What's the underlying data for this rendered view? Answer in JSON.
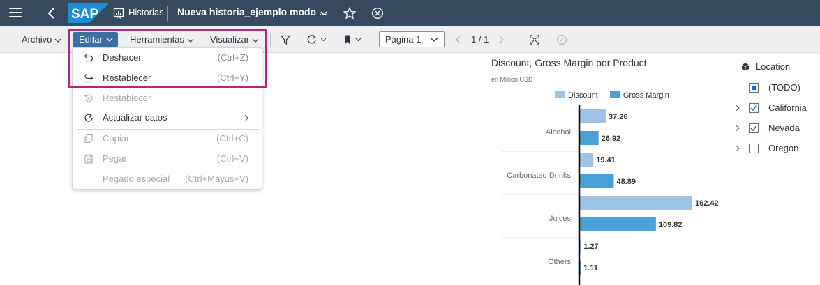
{
  "shell": {
    "logo_text": "SAP",
    "app_name": "Historias",
    "story_title": "Nueva historia_ejemplo modo ..."
  },
  "toolbar": {
    "archivo": "Archivo",
    "editar": "Editar",
    "herramientas": "Herramientas",
    "visualizar": "Visualizar",
    "page_select": "Página 1",
    "page_counter": "1 / 1"
  },
  "menu": {
    "items": [
      {
        "label": "Deshacer",
        "shortcut": "(Ctrl+Z)",
        "icon": "undo-icon",
        "disabled": false
      },
      {
        "label": "Restablecer",
        "shortcut": "(Ctrl+Y)",
        "icon": "redo-icon",
        "disabled": false
      },
      {
        "label": "Restablecer",
        "shortcut": "",
        "icon": "reset-icon",
        "disabled": true
      },
      {
        "label": "Actualizar datos",
        "shortcut": "",
        "icon": "refresh-icon",
        "disabled": false
      },
      {
        "label": "Copiar",
        "shortcut": "(Ctrl+C)",
        "icon": "copy-icon",
        "disabled": true
      },
      {
        "label": "Pegar",
        "shortcut": "(Ctrl+V)",
        "icon": "paste-icon",
        "disabled": true
      },
      {
        "label": "Pegado especial",
        "shortcut": "(Ctrl+Mayús+V)",
        "icon": "",
        "disabled": true
      }
    ],
    "highlight_color": "#b7237d"
  },
  "chart_data": {
    "type": "bar",
    "orientation": "horizontal",
    "title": "Discount, Gross Margin por Product",
    "subtitle": "en Million USD",
    "categories": [
      "Alcohol",
      "Carbonated Drinks",
      "Juices",
      "Others"
    ],
    "series": [
      {
        "name": "Discount",
        "color": "#9fc3e7",
        "values": [
          37.26,
          19.41,
          162.42,
          1.27
        ]
      },
      {
        "name": "Gross Margin",
        "color": "#4aa0d8",
        "values": [
          26.92,
          48.89,
          109.82,
          1.11
        ]
      }
    ],
    "legend_position": "top",
    "grid": false
  },
  "filter": {
    "title": "Location",
    "items": [
      {
        "label": "(TODO)",
        "state": "partial",
        "expandable": false
      },
      {
        "label": "California",
        "state": "checked",
        "expandable": true
      },
      {
        "label": "Nevada",
        "state": "checked",
        "expandable": true
      },
      {
        "label": "Oregon",
        "state": "unchecked",
        "expandable": true
      }
    ]
  },
  "colors": {
    "shell_bg": "#354a5f",
    "toolbar_bg": "#edeff0",
    "accent": "#3e6fa3"
  }
}
